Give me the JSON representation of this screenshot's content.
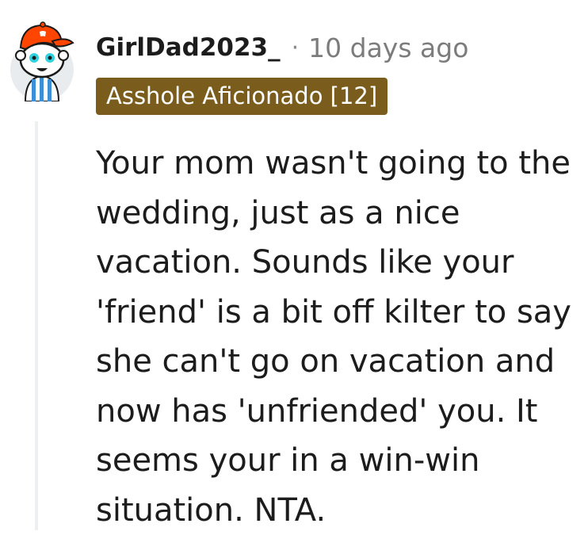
{
  "comment": {
    "username": "GirlDad2023_",
    "separator": "·",
    "timestamp": "10 days ago",
    "flair": "Asshole Aficionado [12]",
    "body": "Your mom wasn't going to the wedding, just as a nice vacation. Sounds like your 'friend' is a bit off kilter to say she can't go on vacation and now has 'unfriended' you. It seems your in a win-win situation. NTA."
  },
  "avatar": {
    "icon": "snoo-avatar-icon",
    "cap_color": "#ff4500",
    "eye_color": "#2fd3e0"
  },
  "colors": {
    "flair_background": "#7a5d1c",
    "thread_line": "#edeff1",
    "text": "#1c1c1c",
    "meta_text": "#7c7c7c"
  }
}
